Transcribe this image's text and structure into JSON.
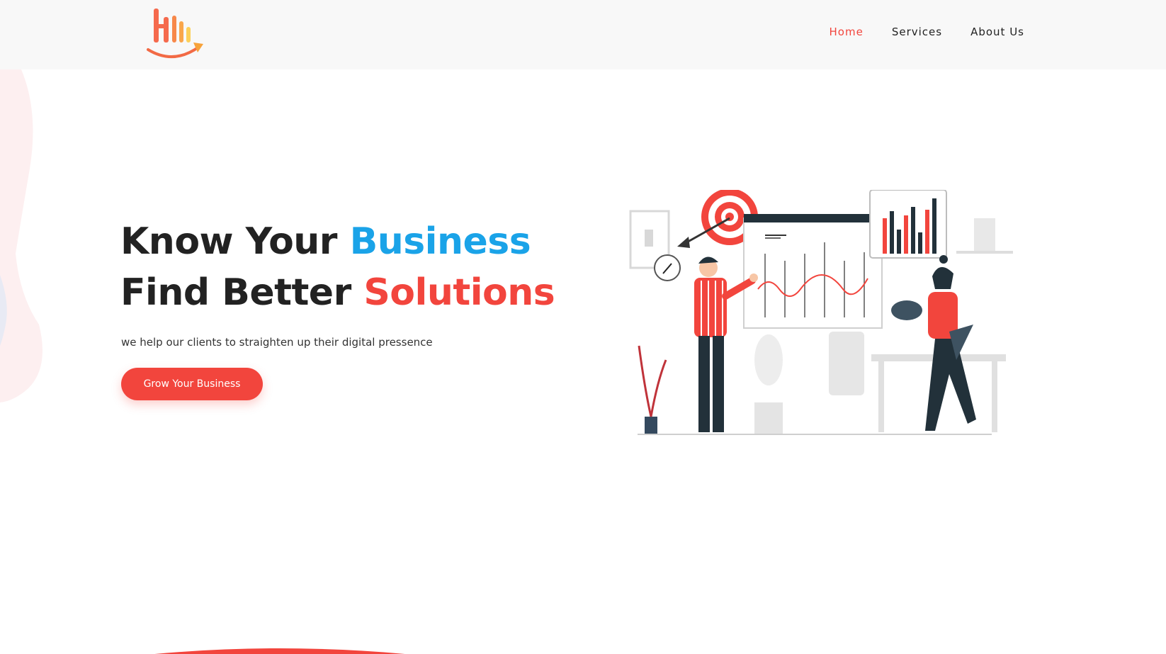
{
  "nav": {
    "items": [
      {
        "label": "Home",
        "active": true
      },
      {
        "label": "Services",
        "active": false
      },
      {
        "label": "About Us",
        "active": false
      }
    ]
  },
  "hero": {
    "line1_prefix": "Know Your",
    "line1_highlight": "Business",
    "line2_prefix": "Find Better",
    "line2_highlight": "Solutions",
    "subtitle": "we help our clients to straighten up their digital pressence",
    "cta_label": "Grow Your Business"
  },
  "colors": {
    "accent_red": "#f2453d",
    "accent_blue": "#1aa3e8",
    "text_dark": "#222222",
    "header_bg": "#f8f8f8"
  },
  "icons": {
    "logo": "bar-chart-growth-logo",
    "illustration": "business-analytics-people-illustration"
  }
}
